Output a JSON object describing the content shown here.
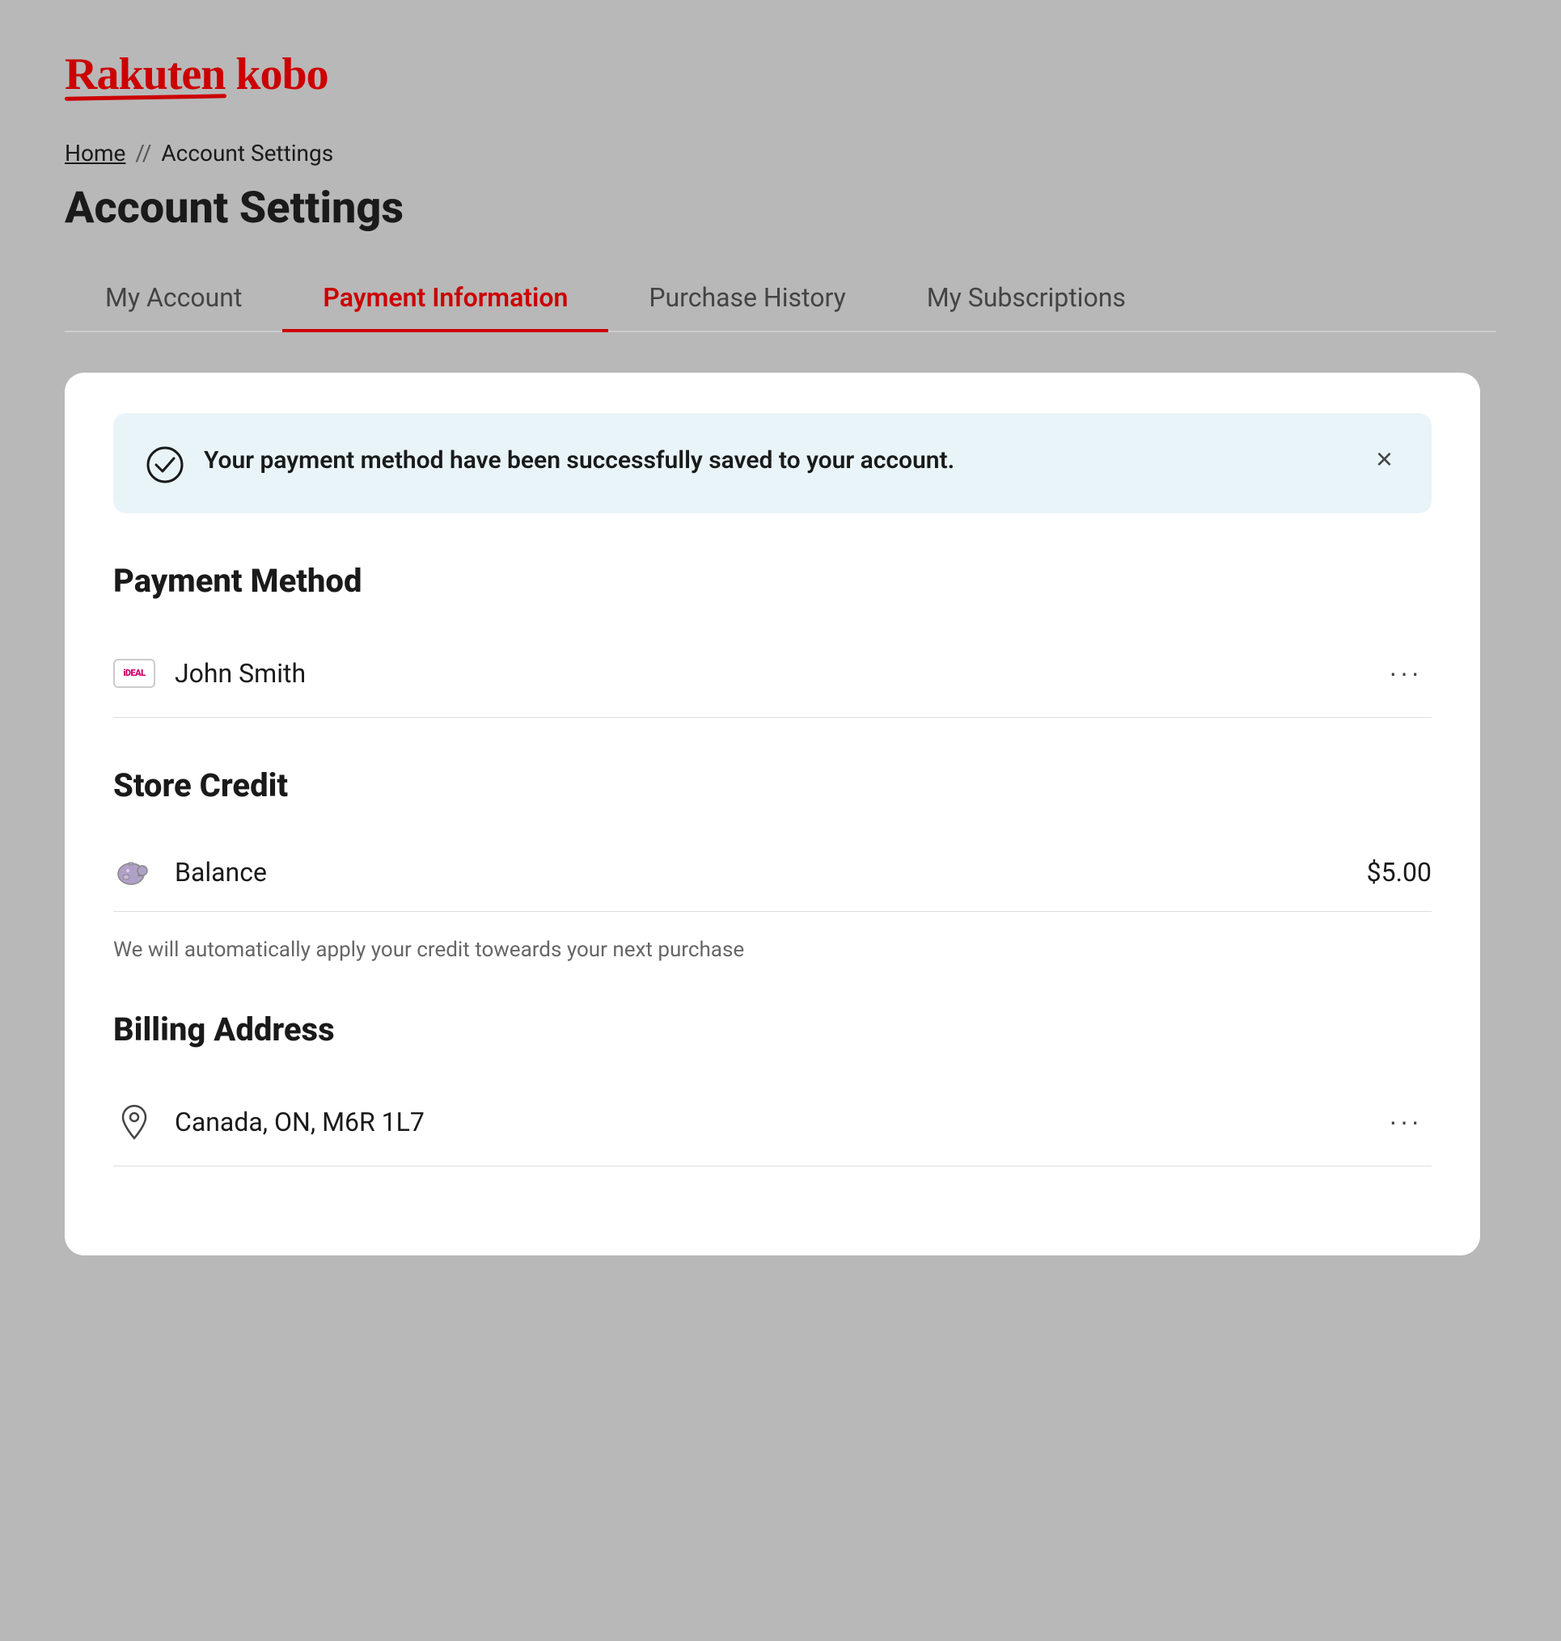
{
  "logo": {
    "text": "Rakuten kobo"
  },
  "breadcrumb": {
    "home_label": "Home",
    "separator": "//",
    "current_label": "Account Settings"
  },
  "page_title": "Account Settings",
  "tabs": [
    {
      "id": "my-account",
      "label": "My Account",
      "active": false
    },
    {
      "id": "payment-information",
      "label": "Payment Information",
      "active": true
    },
    {
      "id": "purchase-history",
      "label": "Purchase History",
      "active": false
    },
    {
      "id": "my-subscriptions",
      "label": "My Subscriptions",
      "active": false
    }
  ],
  "success_banner": {
    "message": "Your payment method have been successfully saved to your account.",
    "close_label": "×"
  },
  "payment_method": {
    "section_title": "Payment Method",
    "items": [
      {
        "icon": "ideal",
        "name": "John Smith",
        "more_label": "···"
      }
    ]
  },
  "store_credit": {
    "section_title": "Store Credit",
    "label": "Balance",
    "value": "$5.00",
    "note": "We will automatically apply your credit toweards your next purchase"
  },
  "billing_address": {
    "section_title": "Billing Address",
    "items": [
      {
        "address": "Canada, ON, M6R 1L7",
        "more_label": "···"
      }
    ]
  }
}
